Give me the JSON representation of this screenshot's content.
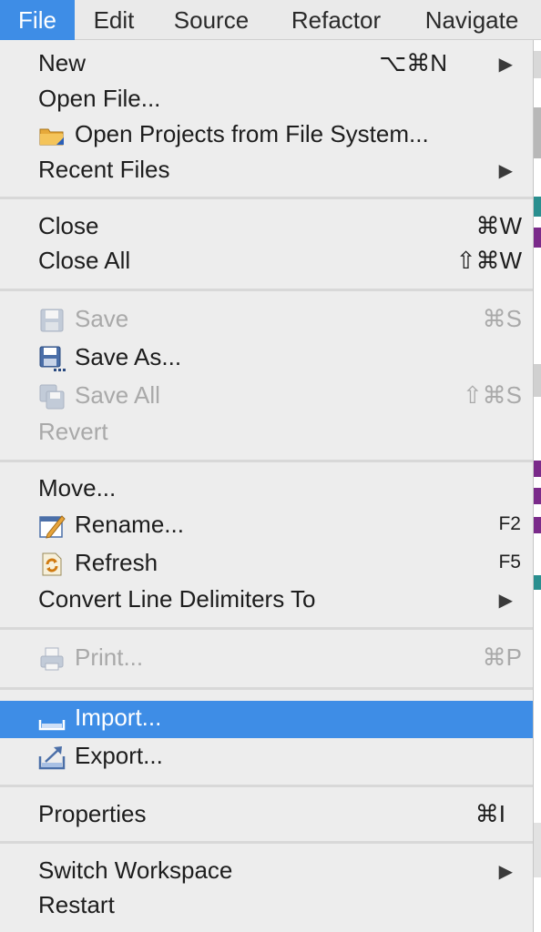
{
  "menubar": {
    "items": [
      {
        "label": "File"
      },
      {
        "label": "Edit"
      },
      {
        "label": "Source"
      },
      {
        "label": "Refactor"
      },
      {
        "label": "Navigate"
      }
    ],
    "active_index": 0
  },
  "file_menu": {
    "new": {
      "label": "New",
      "shortcut": "⌥⌘N",
      "has_submenu": true
    },
    "open_file": {
      "label": "Open File..."
    },
    "open_projects": {
      "label": "Open Projects from File System...",
      "icon": "folder-icon"
    },
    "recent_files": {
      "label": "Recent Files",
      "has_submenu": true
    },
    "close": {
      "label": "Close",
      "shortcut": "⌘W"
    },
    "close_all": {
      "label": "Close All",
      "shortcut": "⇧⌘W"
    },
    "save": {
      "label": "Save",
      "shortcut": "⌘S",
      "disabled": true,
      "icon": "save-icon"
    },
    "save_as": {
      "label": "Save As...",
      "icon": "save-as-icon"
    },
    "save_all": {
      "label": "Save All",
      "shortcut": "⇧⌘S",
      "disabled": true,
      "icon": "save-all-icon"
    },
    "revert": {
      "label": "Revert",
      "disabled": true
    },
    "move": {
      "label": "Move..."
    },
    "rename": {
      "label": "Rename...",
      "shortcut": "F2",
      "icon": "rename-icon"
    },
    "refresh": {
      "label": "Refresh",
      "shortcut": "F5",
      "icon": "refresh-icon"
    },
    "convert": {
      "label": "Convert Line Delimiters To",
      "has_submenu": true
    },
    "print": {
      "label": "Print...",
      "shortcut": "⌘P",
      "disabled": true,
      "icon": "print-icon"
    },
    "import": {
      "label": "Import...",
      "highlighted": true,
      "icon": "import-icon"
    },
    "export": {
      "label": "Export...",
      "icon": "export-icon"
    },
    "properties": {
      "label": "Properties",
      "shortcut": "⌘I"
    },
    "switch_workspace": {
      "label": "Switch Workspace",
      "has_submenu": true
    },
    "restart": {
      "label": "Restart"
    }
  },
  "colors": {
    "highlight": "#3e8de6",
    "menu_bg": "#ededed",
    "disabled_text": "#a9a9a9"
  }
}
